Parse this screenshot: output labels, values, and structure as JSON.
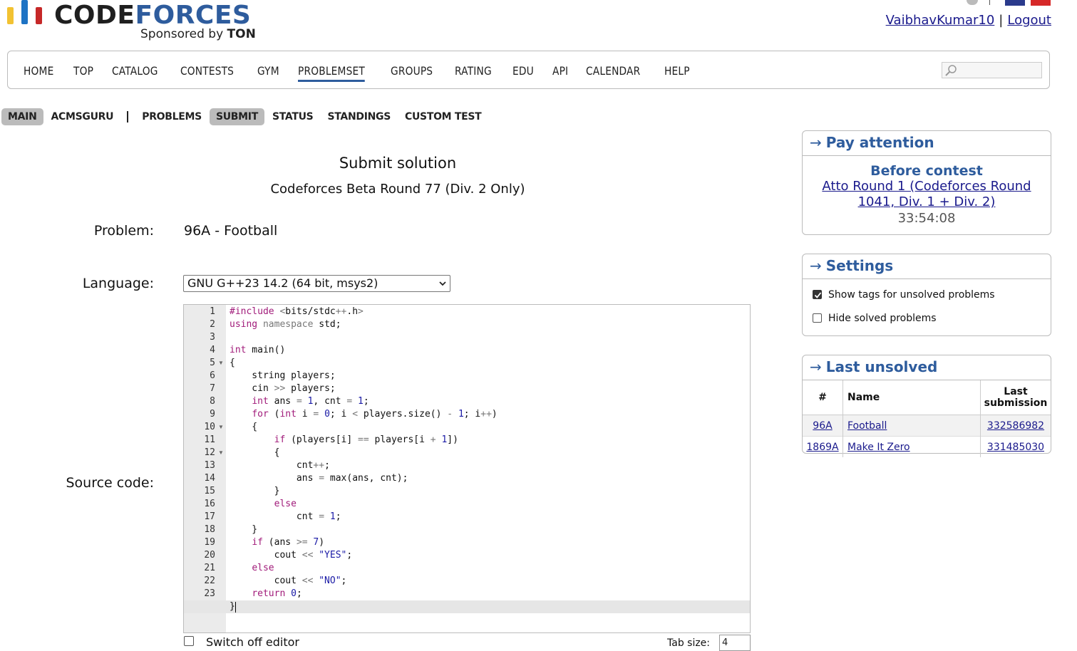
{
  "header": {
    "brand_code": "CODE",
    "brand_forces": "FORCES",
    "sponsor_prefix": "Sponsored by ",
    "sponsor_name": "TON",
    "username": "VaibhavKumar10",
    "separator": "|",
    "logout": "Logout"
  },
  "main_menu": [
    "HOME",
    "TOP",
    "CATALOG",
    "CONTESTS",
    "GYM",
    "PROBLEMSET",
    "GROUPS",
    "RATING",
    "EDU",
    "API",
    "CALENDAR",
    "HELP"
  ],
  "main_menu_active": "PROBLEMSET",
  "sub_menu": {
    "main": "MAIN",
    "acmsguru": "ACMSGURU",
    "problems": "PROBLEMS",
    "submit": "SUBMIT",
    "status": "STATUS",
    "standings": "STANDINGS",
    "custom_test": "CUSTOM TEST"
  },
  "form": {
    "title": "Submit solution",
    "contest": "Codeforces Beta Round 77 (Div. 2 Only)",
    "problem_label": "Problem:",
    "problem_value": "96A - Football",
    "language_label": "Language:",
    "language_value": "GNU G++23 14.2 (64 bit, msys2)",
    "source_label": "Source code:",
    "switch_off_editor": "Switch off editor",
    "tab_size_label": "Tab size:",
    "tab_size_value": "4"
  },
  "code_lines": [
    "#include <bits/stdc++.h>",
    "using namespace std;",
    "",
    "int main()",
    "{",
    "    string players;",
    "    cin >> players;",
    "    int ans = 1, cnt = 1;",
    "    for (int i = 0; i < players.size() - 1; i++)",
    "    {",
    "        if (players[i] == players[i + 1])",
    "        {",
    "            cnt++;",
    "            ans = max(ans, cnt);",
    "        }",
    "        else",
    "            cnt = 1;",
    "    }",
    "    if (ans >= 7)",
    "        cout << \"YES\";",
    "    else",
    "        cout << \"NO\";",
    "    return 0;",
    "}"
  ],
  "fold_lines": [
    5,
    10,
    12
  ],
  "sidebar": {
    "pay_attention": {
      "title": "Pay attention",
      "before_contest": "Before contest",
      "contest_link": "Atto Round 1 (Codeforces Round 1041, Div. 1 + Div. 2)",
      "timer": "33:54:08"
    },
    "settings": {
      "title": "Settings",
      "show_tags": "Show tags for unsolved problems",
      "show_tags_checked": true,
      "hide_solved": "Hide solved problems",
      "hide_solved_checked": false
    },
    "last_unsolved": {
      "title": "Last unsolved",
      "headers": [
        "#",
        "Name",
        "Last submission"
      ],
      "rows": [
        {
          "id": "96A",
          "name": "Football",
          "submission": "332586982"
        },
        {
          "id": "1869A",
          "name": "Make It Zero",
          "submission": "331485030"
        }
      ]
    }
  },
  "colors": {
    "accent": "#2e5c9d",
    "link": "#1a1a8c",
    "keyword": "#a11b7a",
    "number": "#1a1aa6",
    "logo_yellow": "#f2c232",
    "logo_blue": "#1e73c4",
    "logo_red": "#c62828"
  }
}
